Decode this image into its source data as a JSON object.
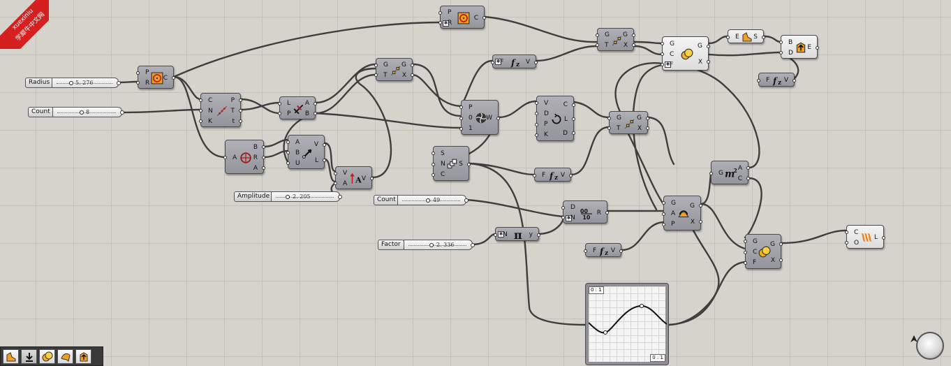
{
  "watermark": {
    "site": "xuexiniu",
    "site_cn": "学犀牛中文网"
  },
  "sliders": [
    {
      "id": "radius",
      "label": "Radius",
      "value": "5. 276"
    },
    {
      "id": "count1",
      "label": "Count",
      "value": "8"
    },
    {
      "id": "amplitude",
      "label": "Amplitude",
      "value": "2. 205"
    },
    {
      "id": "count2",
      "label": "Count",
      "value": "49"
    },
    {
      "id": "factor",
      "label": "Factor",
      "value": "2. 336"
    }
  ],
  "components": {
    "circle_top": {
      "inputs": [
        "P",
        "R"
      ],
      "outputs": [
        "C"
      ],
      "icon": "circle-icon"
    },
    "circle_left": {
      "inputs": [
        "P",
        "R"
      ],
      "outputs": [
        "C"
      ],
      "icon": "circle-icon"
    },
    "divide_curve": {
      "inputs": [
        "C",
        "N",
        "K"
      ],
      "outputs": [
        "P",
        "T",
        "t"
      ],
      "icon": "divide-curve-icon"
    },
    "deconstruct_plane": {
      "inputs": [
        "A"
      ],
      "outputs": [
        "B",
        "R",
        "A"
      ],
      "icon": "target-icon"
    },
    "curve_frame": {
      "inputs": [
        "L",
        "P"
      ],
      "outputs": [
        "A",
        "B"
      ],
      "icon": "frame-icon"
    },
    "vector_2pt": {
      "inputs": [
        "A",
        "B",
        "U"
      ],
      "outputs": [
        "V",
        "L"
      ],
      "icon": "vector-icon"
    },
    "amplitude": {
      "inputs": [
        "V",
        "A"
      ],
      "outputs": [
        "V"
      ],
      "icon": "amplitude-icon"
    },
    "move_1": {
      "inputs": [
        "G",
        "T"
      ],
      "outputs": [
        "G",
        "X"
      ],
      "icon": "move-icon"
    },
    "expr_top": {
      "inputs": [
        "F"
      ],
      "outputs": [
        "V"
      ],
      "icon": "expression-icon"
    },
    "weave": {
      "inputs": [
        "P",
        "0",
        "1"
      ],
      "outputs": [
        "W"
      ],
      "icon": "weave-icon"
    },
    "series_geo": {
      "inputs": [
        "S",
        "N",
        "C"
      ],
      "outputs": [
        "S"
      ],
      "icon": "series-icon"
    },
    "curve_param": {
      "inputs": [
        "V",
        "D",
        "P",
        "K"
      ],
      "outputs": [
        "C",
        "L",
        "D"
      ],
      "icon": "interpolate-icon"
    },
    "move_top": {
      "inputs": [
        "G",
        "T"
      ],
      "outputs": [
        "G",
        "X"
      ],
      "icon": "move-icon"
    },
    "move_mid": {
      "inputs": [
        "G",
        "T"
      ],
      "outputs": [
        "G",
        "X"
      ],
      "icon": "move-icon"
    },
    "expr_mid": {
      "inputs": [
        "F"
      ],
      "outputs": [
        "V"
      ],
      "icon": "expression-icon"
    },
    "range": {
      "inputs": [
        "D",
        "N"
      ],
      "outputs": [
        "R"
      ],
      "icon": "range-icon"
    },
    "pi": {
      "inputs": [
        "N"
      ],
      "outputs": [
        "y"
      ],
      "icon": "pi-icon"
    },
    "expr_low": {
      "inputs": [
        "F"
      ],
      "outputs": [
        "V"
      ],
      "icon": "expression-icon"
    },
    "scale": {
      "inputs": [
        "G",
        "A",
        "P"
      ],
      "outputs": [
        "G",
        "X"
      ],
      "icon": "scale-icon"
    },
    "area": {
      "inputs": [
        "G"
      ],
      "outputs": [
        "A",
        "C"
      ],
      "icon": "area-icon"
    },
    "solid_union_top": {
      "inputs": [
        "G",
        "C",
        "F"
      ],
      "outputs": [
        "G",
        "X"
      ],
      "icon": "solid-union-icon"
    },
    "solid_union_low": {
      "inputs": [
        "G",
        "C",
        "F"
      ],
      "outputs": [
        "G",
        "X"
      ],
      "icon": "solid-union-icon"
    },
    "extrude": {
      "inputs": [
        "E"
      ],
      "outputs": [
        "S"
      ],
      "icon": "extrude-icon"
    },
    "bake": {
      "inputs": [
        "B",
        "D"
      ],
      "outputs": [
        "E"
      ],
      "icon": "bake-icon"
    },
    "expr_right": {
      "inputs": [
        "F"
      ],
      "outputs": [
        "V"
      ],
      "icon": "expression-icon"
    },
    "loft": {
      "inputs": [
        "C",
        "O"
      ],
      "outputs": [
        "L"
      ],
      "icon": "loft-icon"
    }
  },
  "graph_mapper": {
    "domain_top": "0 : 1",
    "domain_bottom": "0 : 1",
    "curve": "sine"
  },
  "toolbar": [
    "extrude-tool-icon",
    "bake-tool-icon",
    "union-tool-icon",
    "surface-tool-icon",
    "bake-out-tool-icon"
  ]
}
